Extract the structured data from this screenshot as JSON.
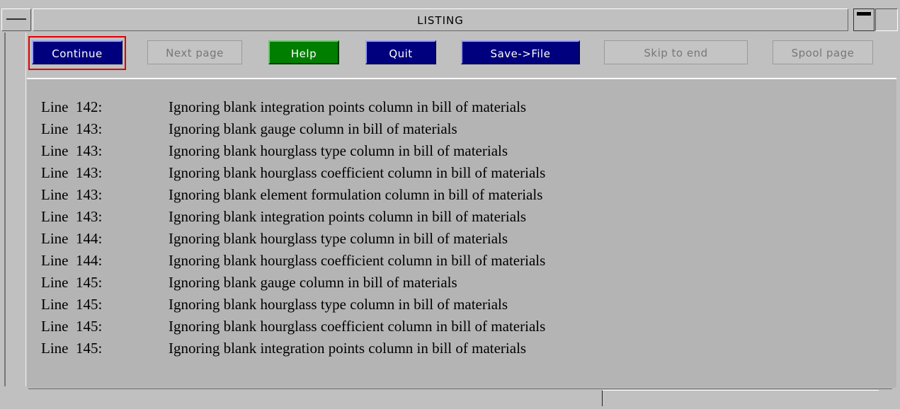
{
  "window": {
    "title": "LISTING"
  },
  "buttons": {
    "continue": "Continue",
    "next_page": "Next page",
    "help": "Help",
    "quit": "Quit",
    "save_file": "Save->File",
    "skip_to_end": "Skip to end",
    "spool_page": "Spool page"
  },
  "colors": {
    "navy_button": "#00007e",
    "green_button": "#007e00",
    "focus_ring": "#e00000",
    "panel_bg": "#b4b4b4"
  },
  "listing": {
    "lines": [
      {
        "prefix": "Line  142:",
        "text": "Ignoring blank integration points column in bill of materials"
      },
      {
        "prefix": "Line  143:",
        "text": "Ignoring blank gauge column in bill of materials"
      },
      {
        "prefix": "Line  143:",
        "text": "Ignoring blank hourglass type column in bill of materials"
      },
      {
        "prefix": "Line  143:",
        "text": "Ignoring blank hourglass coefficient column in bill of materials"
      },
      {
        "prefix": "Line  143:",
        "text": "Ignoring blank element formulation column in bill of materials"
      },
      {
        "prefix": "Line  143:",
        "text": "Ignoring blank integration points column in bill of materials"
      },
      {
        "prefix": "Line  144:",
        "text": "Ignoring blank hourglass type column in bill of materials"
      },
      {
        "prefix": "Line  144:",
        "text": "Ignoring blank hourglass coefficient column in bill of materials"
      },
      {
        "prefix": "Line  145:",
        "text": "Ignoring blank gauge column in bill of materials"
      },
      {
        "prefix": "Line  145:",
        "text": "Ignoring blank hourglass type column in bill of materials"
      },
      {
        "prefix": "Line  145:",
        "text": "Ignoring blank hourglass coefficient column in bill of materials"
      },
      {
        "prefix": "Line  145:",
        "text": "Ignoring blank integration points column in bill of materials"
      }
    ]
  }
}
